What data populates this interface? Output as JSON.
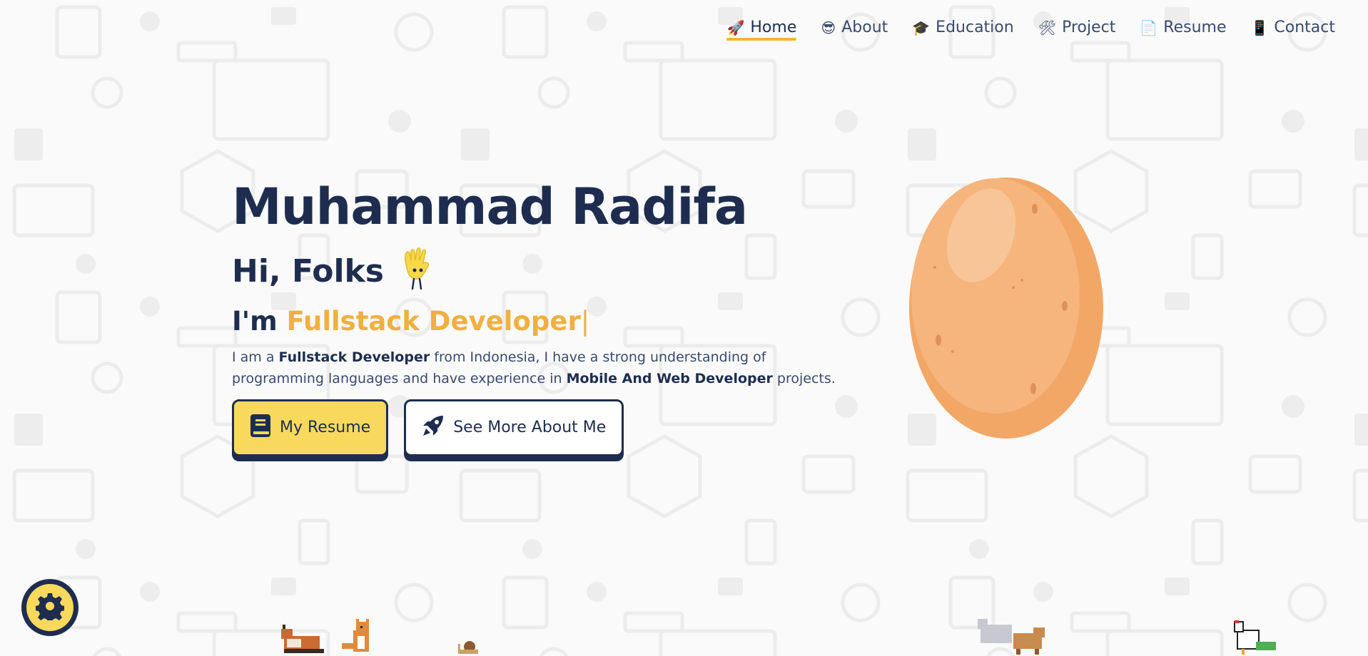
{
  "nav": {
    "items": [
      {
        "label": "Home",
        "icon": "🚀",
        "active": true
      },
      {
        "label": "About",
        "icon": "😎",
        "active": false
      },
      {
        "label": "Education",
        "icon": "🎓",
        "active": false
      },
      {
        "label": "Project",
        "icon": "🛠",
        "active": false
      },
      {
        "label": "Resume",
        "icon": "📄",
        "active": false
      },
      {
        "label": "Contact",
        "icon": "📱",
        "active": false
      }
    ]
  },
  "hero": {
    "name": "Muhammad Radifa",
    "greeting": "Hi, Folks",
    "role_prefix": "I'm",
    "role": "Fullstack Developer",
    "caret": "|",
    "desc_1": "I am a",
    "desc_2": "Fullstack Developer",
    "desc_3": "from Indonesia, I have a strong understanding of programming languages and have experience in",
    "desc_4": "Mobile And Web Developer",
    "desc_5": "projects."
  },
  "buttons": {
    "resume": "My Resume",
    "about": "See More About Me"
  },
  "colors": {
    "accent": "#f0b03f",
    "primary_button": "#f8d95e",
    "text": "#1e2d4f"
  },
  "icons": {
    "settings": "gear-icon",
    "resume": "book-icon",
    "about": "rocket-icon"
  }
}
